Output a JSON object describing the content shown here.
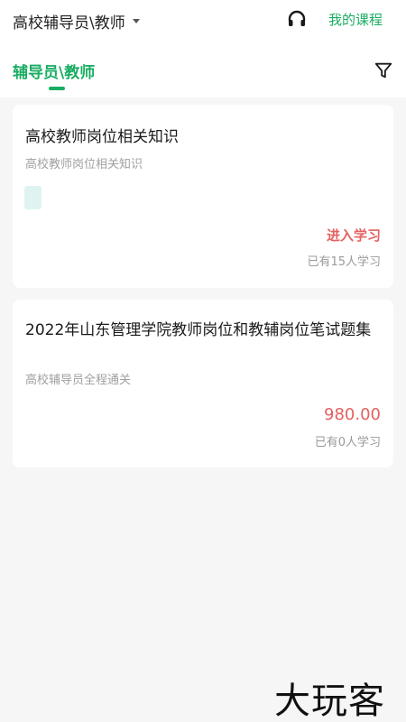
{
  "header": {
    "category": "高校辅导员\\教师",
    "my_course": "我的课程",
    "tab_label": "辅导员\\教师"
  },
  "courses": [
    {
      "title": "高校教师岗位相关知识",
      "subtitle": "高校教师岗位相关知识",
      "action": "进入学习",
      "learners": "已有15人学习"
    },
    {
      "title": "2022年山东管理学院教师岗位和教辅岗位笔试题集",
      "subtitle": "高校辅导员全程通关",
      "price": "980.00",
      "learners": "已有0人学习"
    }
  ],
  "watermark": "大玩客",
  "icons": {
    "headset": "headset-icon",
    "filter": "filter-icon",
    "caret": "chevron-down-icon"
  },
  "colors": {
    "accent": "#1aad63",
    "price": "#e56161",
    "background": "#f6f6f6"
  }
}
